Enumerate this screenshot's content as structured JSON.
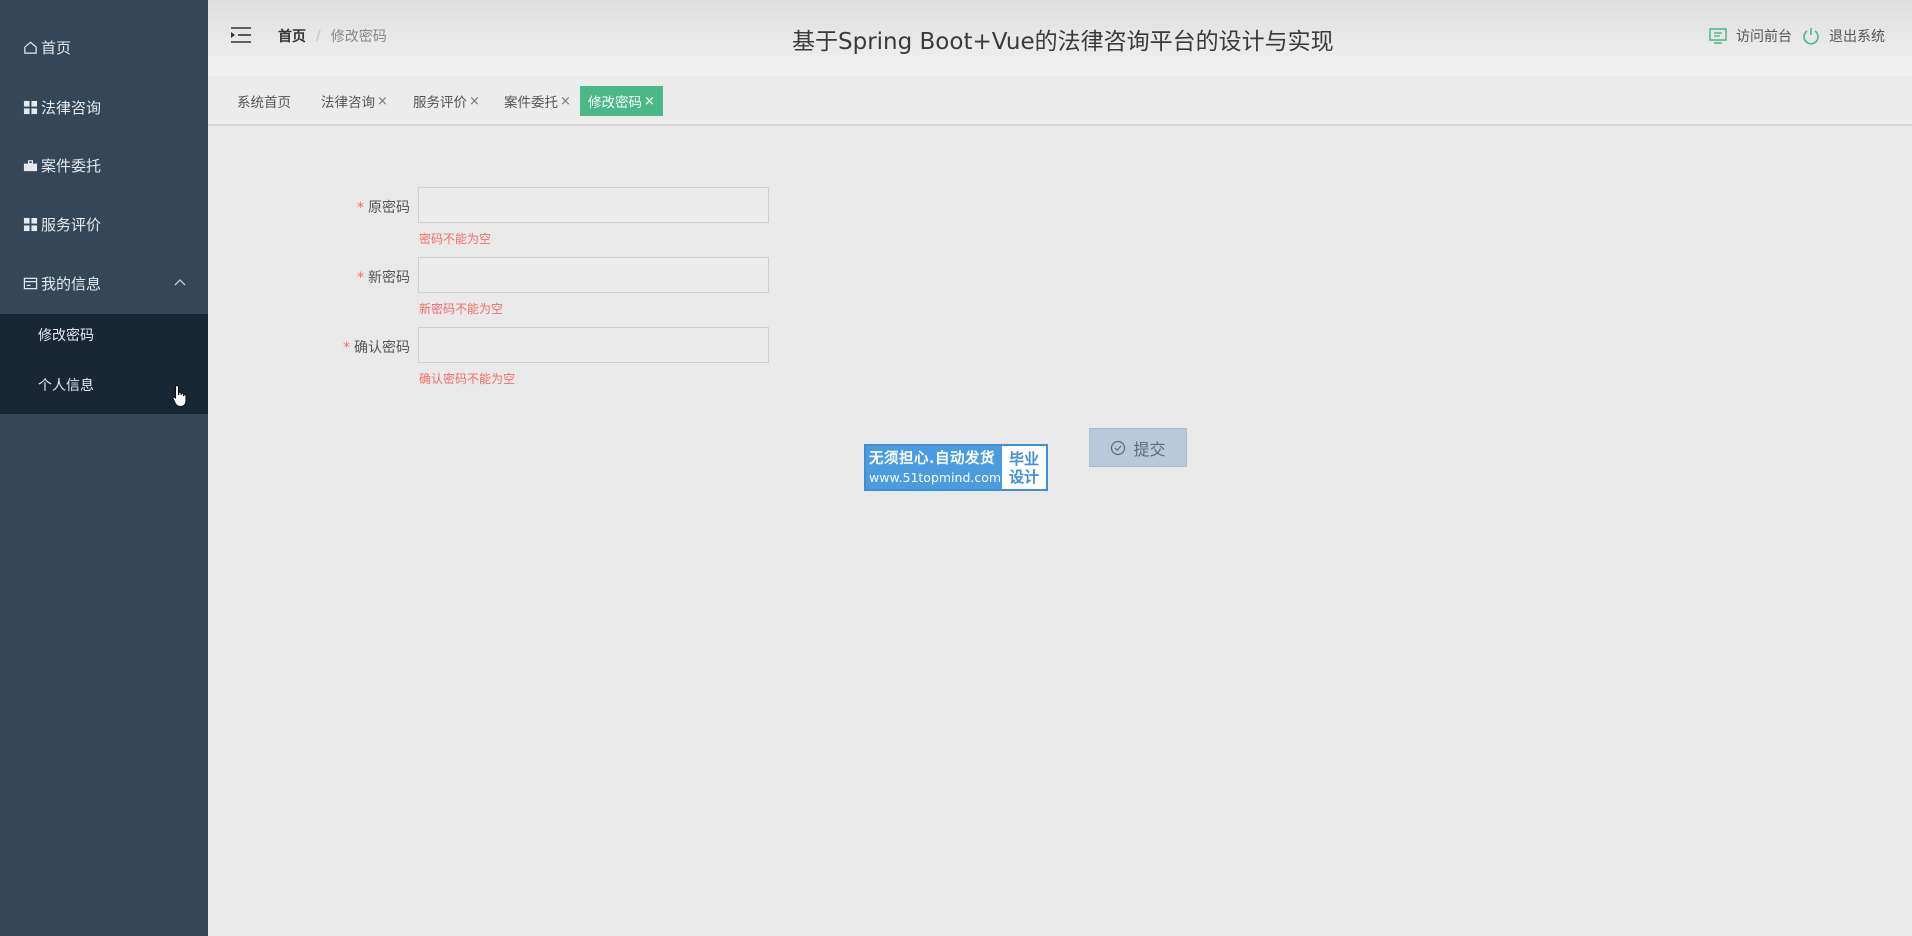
{
  "sidebar": {
    "items": [
      {
        "label": "首页",
        "icon": "home-icon"
      },
      {
        "label": "法律咨询",
        "icon": "grid-icon"
      },
      {
        "label": "案件委托",
        "icon": "briefcase-icon"
      },
      {
        "label": "服务评价",
        "icon": "grid-icon"
      },
      {
        "label": "我的信息",
        "icon": "card-icon",
        "expanded": true
      }
    ],
    "sub_items": [
      {
        "label": "修改密码",
        "active": true
      },
      {
        "label": "个人信息"
      }
    ]
  },
  "header": {
    "breadcrumb_home": "首页",
    "breadcrumb_separator": "/",
    "breadcrumb_current": "修改密码",
    "title": "基于Spring Boot+Vue的法律咨询平台的设计与实现",
    "visit_frontend": "访问前台",
    "logout": "退出系统",
    "accent_color": "#4ab889"
  },
  "tags": [
    {
      "label": "系统首页",
      "closable": false
    },
    {
      "label": "法律咨询",
      "closable": true
    },
    {
      "label": "服务评价",
      "closable": true
    },
    {
      "label": "案件委托",
      "closable": true
    },
    {
      "label": "修改密码",
      "closable": true,
      "active": true
    }
  ],
  "tag_close": "×",
  "form": {
    "required_mark": "*",
    "fields": [
      {
        "label": "原密码",
        "value": "",
        "error": "密码不能为空"
      },
      {
        "label": "新密码",
        "value": "",
        "error": "新密码不能为空"
      },
      {
        "label": "确认密码",
        "value": "",
        "error": "确认密码不能为空"
      }
    ],
    "submit_label": "提交"
  },
  "watermark": {
    "line1": "无须担心.自动发货",
    "line2": "www.51topmind.com",
    "right_top": "毕业",
    "right_bottom": "设计"
  }
}
